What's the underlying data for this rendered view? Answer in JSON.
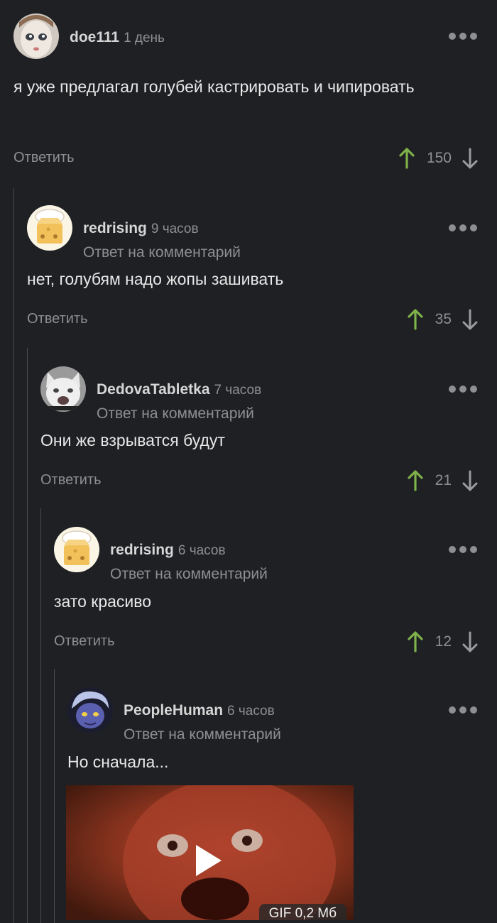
{
  "reply_label": "Ответить",
  "reply_to_label": "Ответ на комментарий",
  "comments": [
    {
      "author": "doe111",
      "time": "1 день",
      "text": "я уже предлагал голубей кастрировать и чипировать",
      "score": "150",
      "avatar": "doll-face-avatar"
    },
    {
      "author": "redrising",
      "time": "9 часов",
      "text": "нет, голубям надо жопы зашивать",
      "score": "35",
      "avatar": "cheese-chef-avatar"
    },
    {
      "author": "DedovaTabletka",
      "time": "7 часов",
      "text": "Они же взрыватся будут",
      "score": "21",
      "avatar": "white-cat-avatar"
    },
    {
      "author": "redrising",
      "time": "6 часов",
      "text": "зато красиво",
      "score": "12",
      "avatar": "cheese-chef-avatar"
    },
    {
      "author": "PeopleHuman",
      "time": "6 часов",
      "text": "Но сначала...",
      "avatar": "blue-creature-avatar",
      "gif_badge": "GIF 0,2 Мб"
    }
  ],
  "colors": {
    "background": "#1e2023",
    "upvote": "#7fb24a",
    "muted": "#8d8f93"
  }
}
